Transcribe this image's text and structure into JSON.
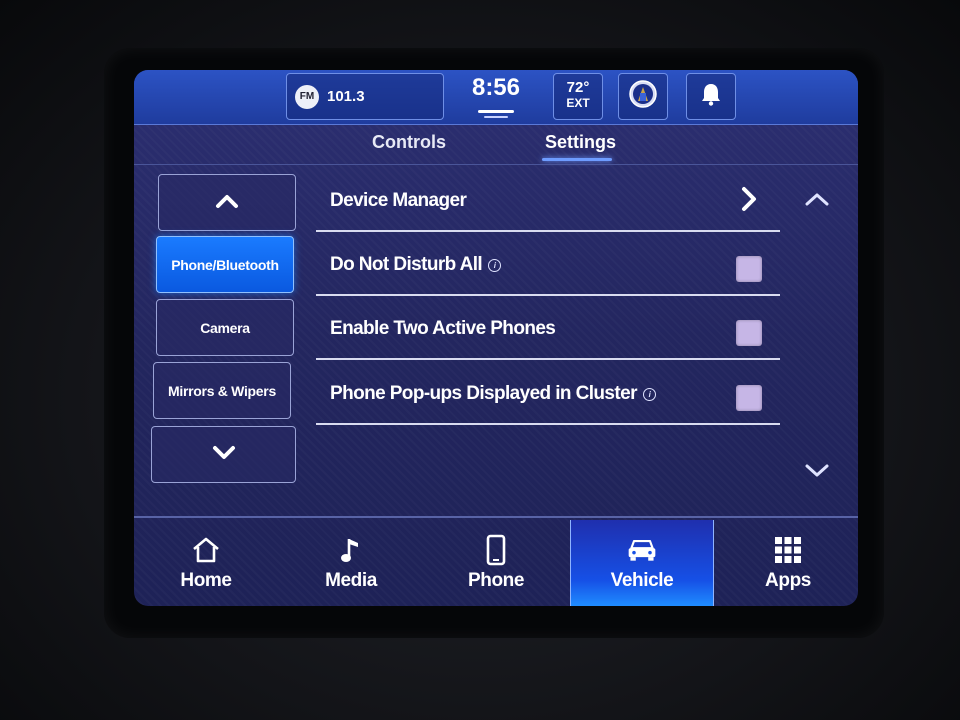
{
  "status": {
    "radio_band": "FM",
    "radio_freq": "101.3",
    "time": "8:56",
    "temp_value": "72°",
    "temp_unit": "EXT"
  },
  "tabs": [
    {
      "label": "Controls",
      "active": false
    },
    {
      "label": "Settings",
      "active": true
    }
  ],
  "categories": {
    "items": [
      {
        "label": "Phone/Bluetooth",
        "selected": true
      },
      {
        "label": "Camera",
        "selected": false
      },
      {
        "label": "Mirrors & Wipers",
        "selected": false
      }
    ]
  },
  "settings": {
    "rows": [
      {
        "label": "Device Manager",
        "control": "chevron-right-icon"
      },
      {
        "label": "Do Not Disturb All",
        "control": "checkbox",
        "checked": false,
        "info": true
      },
      {
        "label": "Enable Two Active Phones",
        "control": "checkbox",
        "checked": false
      },
      {
        "label": "Phone Pop-ups Displayed in Cluster",
        "control": "checkbox",
        "checked": false,
        "info": true
      }
    ]
  },
  "nav": {
    "items": [
      {
        "label": "Home",
        "icon": "home-icon",
        "active": false
      },
      {
        "label": "Media",
        "icon": "music-note-icon",
        "active": false
      },
      {
        "label": "Phone",
        "icon": "phone-icon",
        "active": false
      },
      {
        "label": "Vehicle",
        "icon": "car-icon",
        "active": true
      },
      {
        "label": "Apps",
        "icon": "apps-grid-icon",
        "active": false
      }
    ]
  },
  "colors": {
    "accent": "#1a7bff",
    "status_bar": "#2c53c4",
    "background": "#23265f",
    "checkbox": "#c6b6e6"
  }
}
